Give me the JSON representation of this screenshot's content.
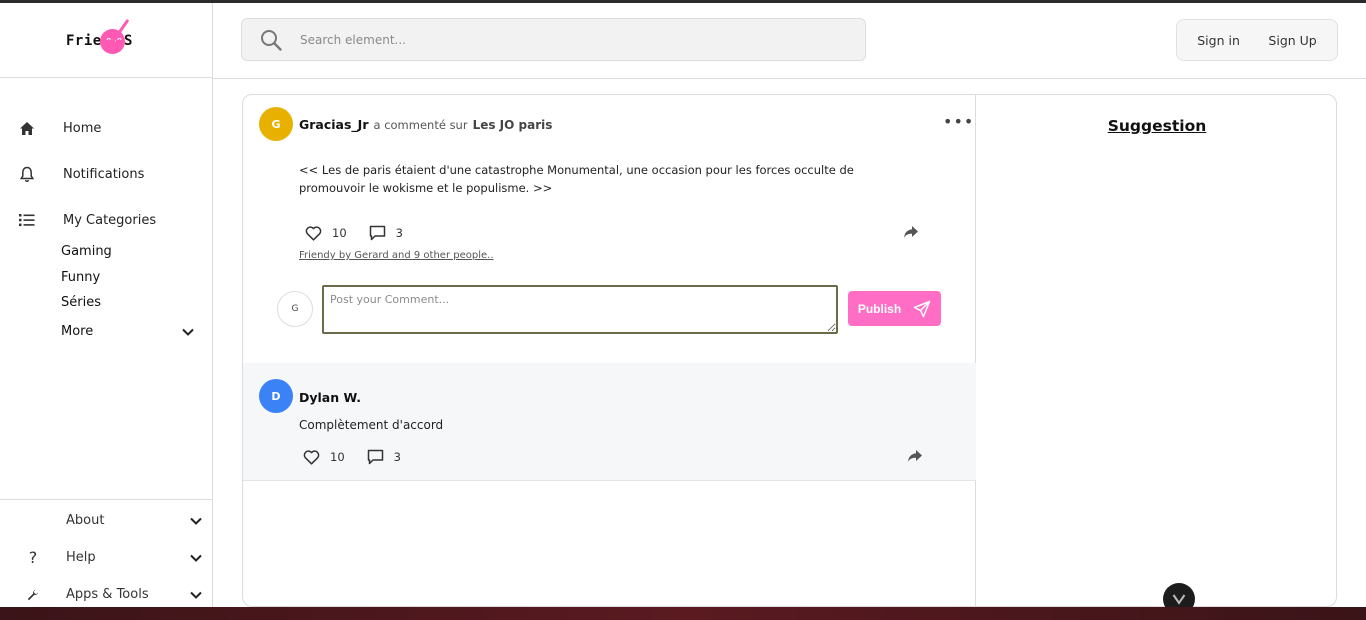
{
  "brand": {
    "logo_text": "Frien",
    "logo_tail": "S",
    "pink": "#ff59b4"
  },
  "search": {
    "placeholder": "Search element..."
  },
  "auth": {
    "sign_in": "Sign in",
    "sign_up": "Sign Up"
  },
  "sidebar": {
    "nav": [
      {
        "label": "Home",
        "icon": "home-icon"
      },
      {
        "label": "Notifications",
        "icon": "bell-icon"
      },
      {
        "label": "My Categories",
        "icon": "list-icon"
      }
    ],
    "categories": [
      "Gaming",
      "Funny",
      "Séries"
    ],
    "more_label": "More",
    "bottom": [
      {
        "label": "About",
        "icon": ""
      },
      {
        "label": "Help",
        "icon": "question-icon"
      },
      {
        "label": "Apps & Tools",
        "icon": "wrench-icon"
      }
    ]
  },
  "post": {
    "avatar_initial": "G",
    "author": "Gracias_Jr",
    "action": "a commenté sur",
    "topic": "Les JO paris",
    "text": "<< Les de paris étaient d'une catastrophe Monumental, une occasion pour les forces occulte de promouvoir le wokisme et le populisme. >>",
    "likes": "10",
    "comments": "3",
    "liked_by": "Friendy by Gerard and 9 other people..",
    "comment_avatar_initial": "G",
    "comment_placeholder": "Post your Comment...",
    "publish_label": "Publish",
    "avatar_color": "#e8b100"
  },
  "reply": {
    "avatar_initial": "D",
    "author": "Dylan W.",
    "text": "Complètement d'accord",
    "likes": "10",
    "comments": "3",
    "avatar_color": "#3b82f6"
  },
  "suggestion": {
    "title": "Suggestion"
  },
  "colors": {
    "publish": "#ff6ec4"
  }
}
